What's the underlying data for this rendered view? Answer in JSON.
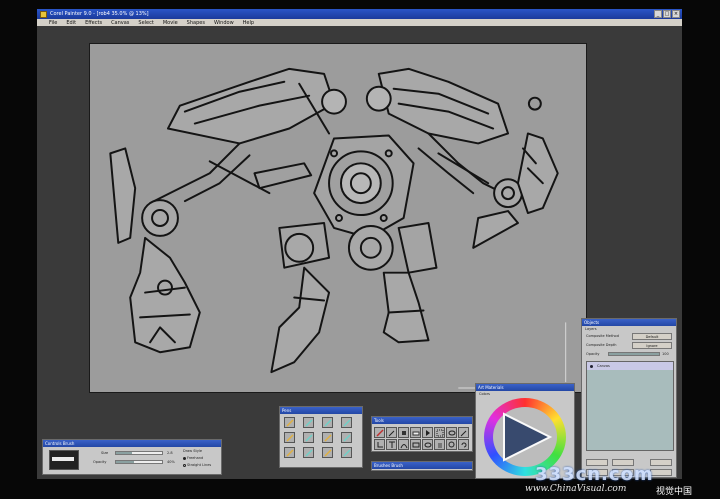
{
  "window": {
    "title": "Corel Painter 9.0 - [rob4 35.0% @ 13%]",
    "minimize": "_",
    "maximize": "□",
    "close": "×"
  },
  "menu": [
    "File",
    "Edit",
    "Effects",
    "Canvas",
    "Select",
    "Movie",
    "Shapes",
    "Window",
    "Help"
  ],
  "panels": {
    "brush": {
      "title": "Controls Brush",
      "size_label": "Size",
      "opacity_label": "Opacity",
      "size_value": "2.8",
      "opacity_value": "40%",
      "size_level": 0.35,
      "opacity_level": 0.4,
      "draw_style_label": "Draw Style",
      "freehand_label": "Freehand",
      "straight_lines_label": "Straight Lines"
    },
    "pens": {
      "title": "Pens"
    },
    "tools": {
      "title": "Tools"
    },
    "brush_bar": {
      "title": "Brushes Brush"
    },
    "colors": {
      "title": "Art Materials",
      "subtitle": "Colors"
    },
    "layers": {
      "title": "Objects",
      "subtitle": "Layers",
      "composite_method_label": "Composite Method",
      "composite_method_value": "Default",
      "composite_depth_label": "Composite Depth",
      "composite_depth_value": "Ignore",
      "opacity_label": "Opacity",
      "opacity_value": "100",
      "opacity_level": 1.0,
      "layer_name": "Canvas"
    }
  },
  "watermark": {
    "main": "333cn.com",
    "sub": "www.ChinaVisual.com",
    "cn": "视觉中国"
  }
}
